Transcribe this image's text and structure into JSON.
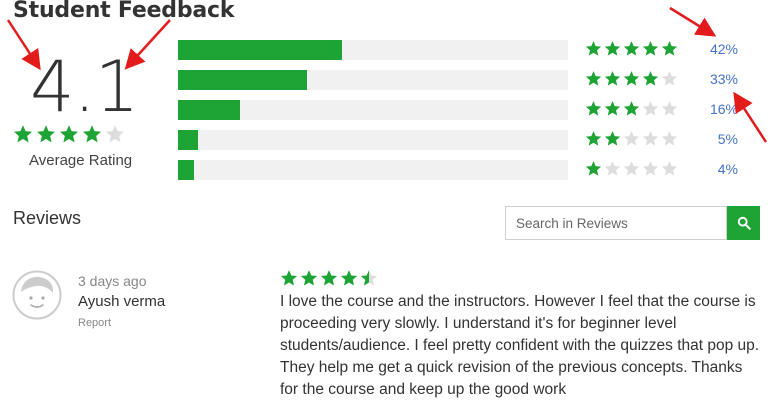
{
  "header": {
    "title": "Student Feedback"
  },
  "summary": {
    "average": "4.1",
    "average_label": "Average Rating",
    "average_stars": 4
  },
  "distribution": [
    {
      "stars": 5,
      "percent": "42%",
      "fraction": 0.42
    },
    {
      "stars": 4,
      "percent": "33%",
      "fraction": 0.33
    },
    {
      "stars": 3,
      "percent": "16%",
      "fraction": 0.16
    },
    {
      "stars": 2,
      "percent": "5%",
      "fraction": 0.05
    },
    {
      "stars": 1,
      "percent": "4%",
      "fraction": 0.04
    }
  ],
  "reviews_section": {
    "heading": "Reviews",
    "search_placeholder": "Search in Reviews",
    "search_icon": "search-icon"
  },
  "review": {
    "avatar_icon": "avatar-icon",
    "date": "3 days ago",
    "user": "Ayush verma",
    "report_label": "Report",
    "rating": 4.5,
    "text": "I love the course and the instructors. However I feel that the course is proceeding very slowly. I understand it's for beginner level students/audience. I feel pretty confident with the quizzes that pop up. They help me get a quick revision of the previous concepts. Thanks for the course and keep up the good work"
  },
  "colors": {
    "star_filled": "#1ea335",
    "star_empty": "#dddddd",
    "bar_fill": "#1ea335",
    "bar_track": "#f1f1f1",
    "percent_link": "#4472c4",
    "annotation_arrow": "#e31b1b"
  }
}
